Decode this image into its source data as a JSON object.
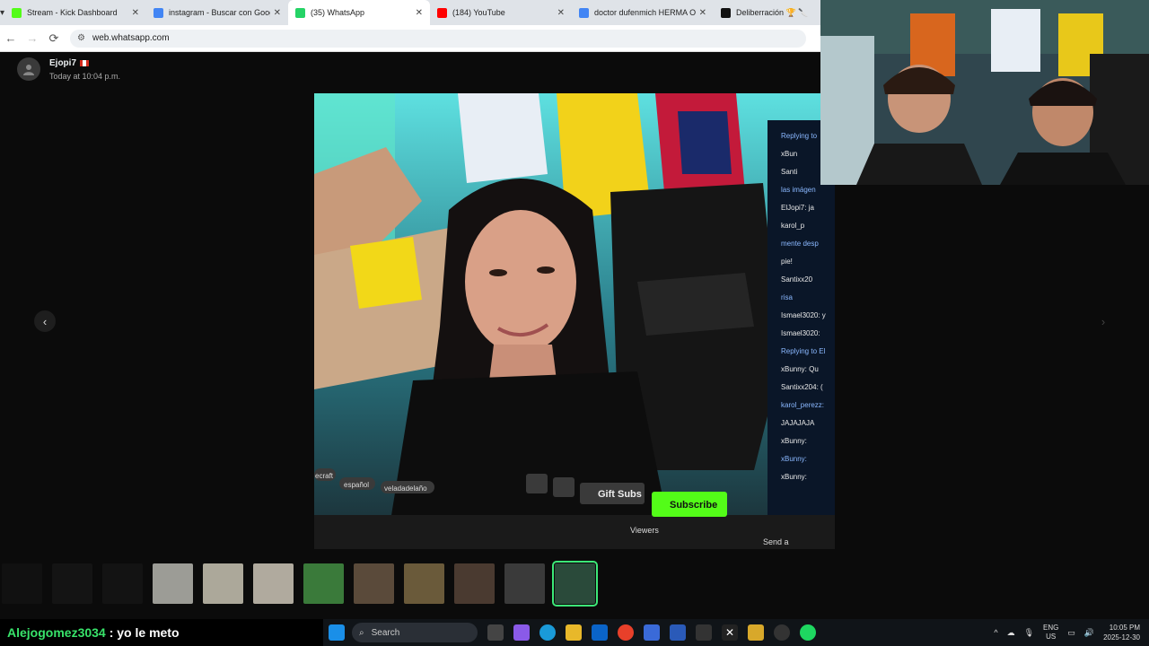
{
  "browser": {
    "tabs": [
      {
        "title": "Stream - Kick Dashboard",
        "color": "#53fc18"
      },
      {
        "title": "instagram - Buscar con Google",
        "color": "#4285f4"
      },
      {
        "title": "(35) WhatsApp",
        "color": "#25d366"
      },
      {
        "title": "(184) YouTube",
        "color": "#ff0000"
      },
      {
        "title": "doctor dufenmich HERMA O -",
        "color": "#4285f4"
      },
      {
        "title": "Deliberración 🏆 🔪",
        "color": "#111111"
      }
    ],
    "active_tab": 2,
    "url": "web.whatsapp.com"
  },
  "viewer": {
    "sender": "Ejopi7",
    "timestamp": "Today at 10:04 p.m."
  },
  "photo": {
    "overlay": {
      "tags": [
        "ecraft",
        "español",
        "veladadelaño"
      ],
      "gift_subs": "Gift Subs",
      "subscribe": "Subscribe",
      "viewers": "Viewers",
      "send": "Send a message",
      "chat": [
        "Replying to",
        "xBun",
        "Santi",
        "las imágen",
        "ElJopi7: ja",
        "karol_p",
        "mente desp",
        "pie!",
        "Santixx20",
        "risa",
        "Ismael3020: y",
        "Ismael3020:",
        "Replying to El",
        "xBunny: Qu",
        "Santixx204: (",
        "karol_perezz:",
        "JAJAJAJA",
        "xBunny:",
        "xBunny:",
        "xBunny:"
      ]
    }
  },
  "thumbnails": {
    "count": 12,
    "selected": 11,
    "colors": [
      "#111111",
      "#141414",
      "#131313",
      "#9c9c96",
      "#aca89a",
      "#b0aa9e",
      "#3a7a3a",
      "#5a4a3a",
      "#6a5a3a",
      "#4a3a30",
      "#3a3a3a",
      "#2a4a3a"
    ]
  },
  "chat_overlay": {
    "user": "Alejogomez3034",
    "message": ": yo le meto"
  },
  "taskbar": {
    "search_placeholder": "Search",
    "lang_top": "ENG",
    "lang_bottom": "US",
    "time": "10:05 PM",
    "date": "2025-12-30"
  }
}
